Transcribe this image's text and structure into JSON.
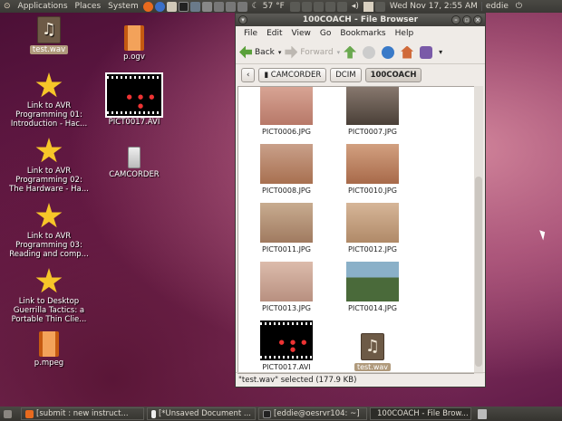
{
  "top_panel": {
    "menus": [
      "Applications",
      "Places",
      "System"
    ],
    "temperature": "57 °F",
    "datetime": "Wed Nov 17,  2:55 AM",
    "user": "eddie"
  },
  "desktop": {
    "icons": [
      {
        "label": "test.wav",
        "icon": "music-file-icon"
      },
      {
        "label": "p.ogv",
        "icon": "video-file-icon"
      },
      {
        "label": "Link to AVR Programming 01: Introduction - Hac...",
        "icon": "star-icon"
      },
      {
        "label": "PICT0017.AVI",
        "icon": "video-thumbnail"
      },
      {
        "label": "Link to AVR Programming 02: The Hardware - Ha...",
        "icon": "star-icon"
      },
      {
        "label": "CAMCORDER",
        "icon": "usb-drive-icon"
      },
      {
        "label": "Link to AVR Programming 03: Reading and comp...",
        "icon": "star-icon"
      },
      {
        "label": "Link to Desktop Guerrilla Tactics: a Portable Thin Clie...",
        "icon": "star-icon"
      },
      {
        "label": "p.mpeg",
        "icon": "video-file-icon"
      }
    ]
  },
  "window": {
    "title": "100COACH - File Browser",
    "menu": [
      "File",
      "Edit",
      "View",
      "Go",
      "Bookmarks",
      "Help"
    ],
    "toolbar": {
      "back": "Back",
      "forward": "Forward"
    },
    "breadcrumbs": [
      "CAMCORDER",
      "DCIM",
      "100COACH"
    ],
    "files": [
      {
        "name": "PICT0006.JPG",
        "color": "#c98a7a"
      },
      {
        "name": "PICT0007.JPG",
        "color": "#6a5a50"
      },
      {
        "name": "PICT0008.JPG",
        "color": "#b88a70"
      },
      {
        "name": "PICT0010.JPG",
        "color": "#c08a6a"
      },
      {
        "name": "PICT0011.JPG",
        "color": "#b89a80"
      },
      {
        "name": "PICT0012.JPG",
        "color": "#c0a080"
      },
      {
        "name": "PICT0013.JPG",
        "color": "#c8a898"
      },
      {
        "name": "PICT0014.JPG",
        "color": "#4a5a3a"
      },
      {
        "name": "PICT0017.AVI",
        "color": "#000000"
      },
      {
        "name": "test.wav",
        "color": "#6d5a46"
      }
    ],
    "status": "\"test.wav\" selected (177.9 KB)"
  },
  "taskbar": [
    "[submit : new instruct...",
    "[*Unsaved Document ...",
    "[eddie@oesrvr104: ~]",
    "100COACH - File Brow..."
  ]
}
